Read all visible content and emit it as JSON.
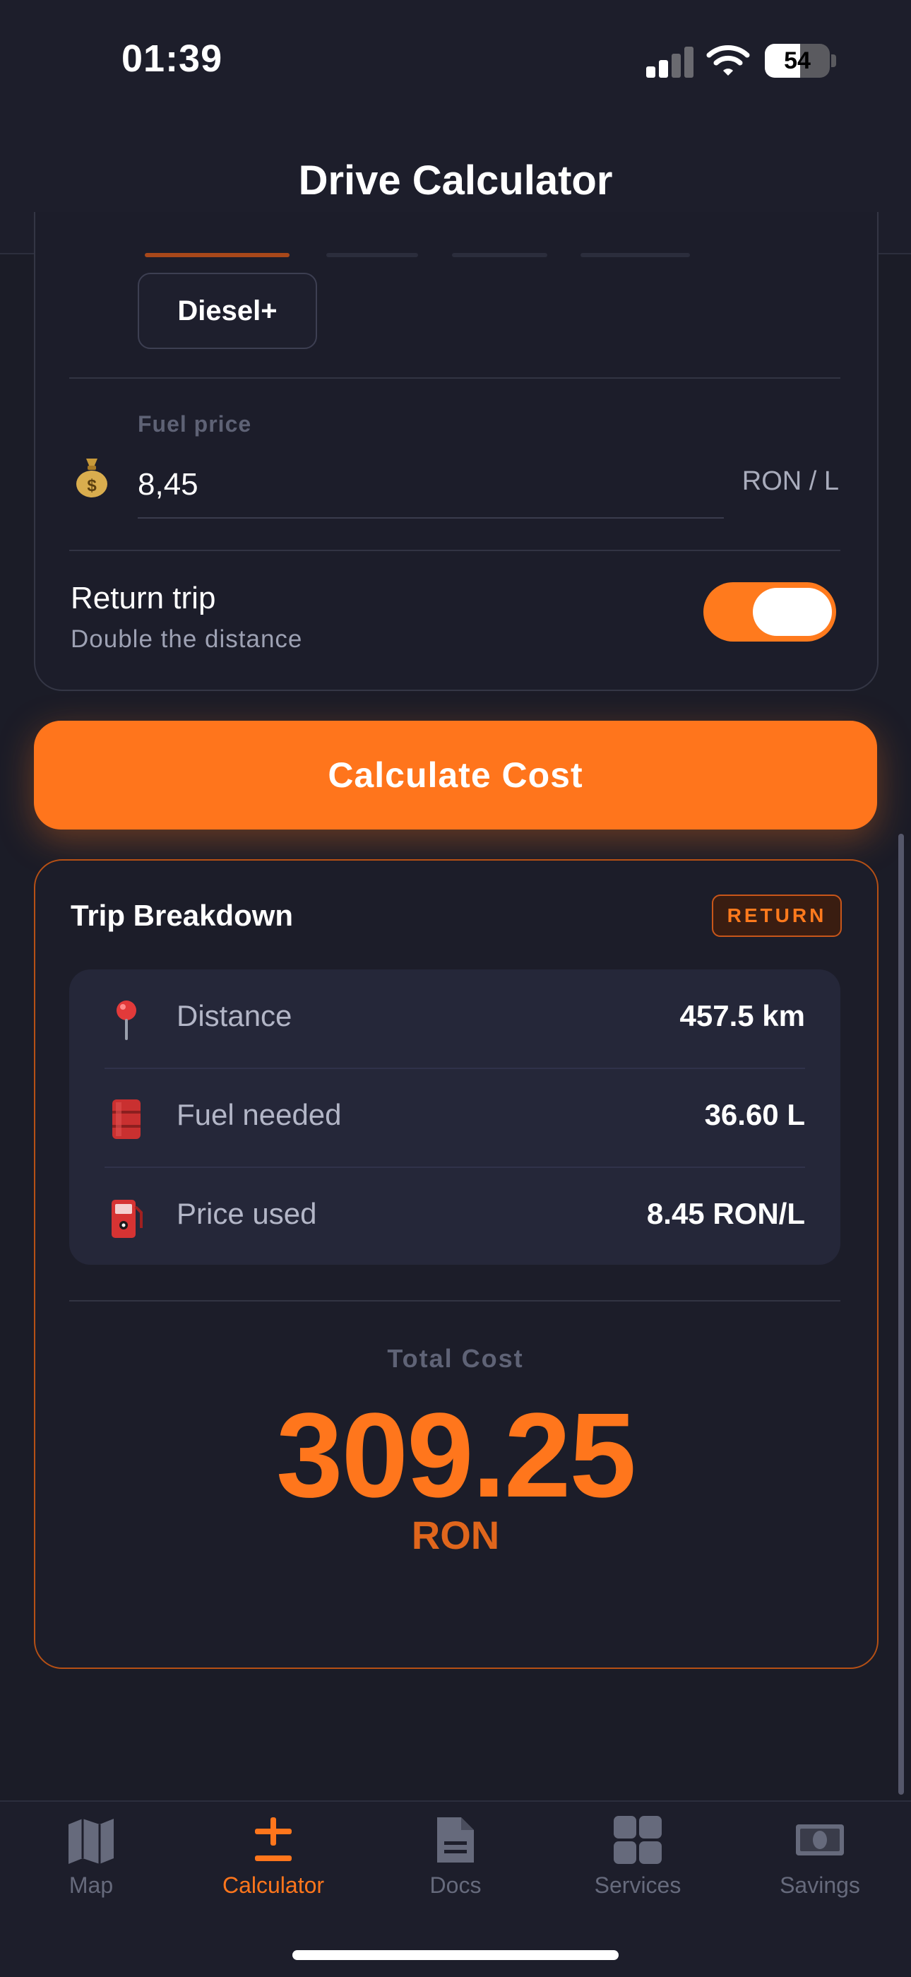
{
  "status_bar": {
    "time": "01:39",
    "battery": "54"
  },
  "header": {
    "title": "Drive Calculator"
  },
  "fuel_type": {
    "selected_chip": "Diesel+",
    "accent": "#ff7a1d"
  },
  "fuel_price": {
    "label": "Fuel price",
    "value": "8,45",
    "unit": "RON / L",
    "icon": "money-bag-icon"
  },
  "return_trip": {
    "title": "Return trip",
    "subtitle": "Double the distance",
    "enabled": true
  },
  "calculate_button": {
    "label": "Calculate Cost"
  },
  "breakdown": {
    "title": "Trip Breakdown",
    "badge": "RETURN",
    "rows": [
      {
        "icon": "pin-icon",
        "label": "Distance",
        "value": "457.5 km"
      },
      {
        "icon": "oil-drum-icon",
        "label": "Fuel needed",
        "value": "36.60 L"
      },
      {
        "icon": "fuel-pump-icon",
        "label": "Price used",
        "value": "8.45 RON/L"
      }
    ],
    "total_label": "Total Cost",
    "total_value": "309.25",
    "total_currency": "RON"
  },
  "tabs": [
    {
      "icon": "map-icon",
      "label": "Map",
      "active": false
    },
    {
      "icon": "plus-minus-icon",
      "label": "Calculator",
      "active": true
    },
    {
      "icon": "document-icon",
      "label": "Docs",
      "active": false
    },
    {
      "icon": "grid-icon",
      "label": "Services",
      "active": false
    },
    {
      "icon": "banknote-icon",
      "label": "Savings",
      "active": false
    }
  ],
  "colors": {
    "background": "#1b1c27",
    "accent": "#ff761c",
    "card_border": "#b65015",
    "inactive": "#666a7c"
  }
}
